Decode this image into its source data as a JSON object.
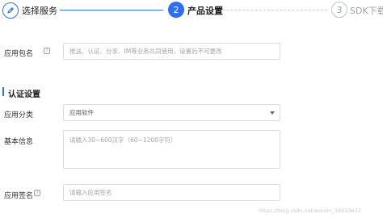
{
  "stepper": {
    "steps": [
      {
        "number": "",
        "label": "选择服务",
        "state": "done"
      },
      {
        "number": "2",
        "label": "产品设置",
        "state": "active"
      },
      {
        "number": "3",
        "label": "SDK下载",
        "state": "pending"
      }
    ]
  },
  "form": {
    "package_name": {
      "label": "应用包名",
      "help": "?",
      "placeholder": "推送、认证、分享、IM等业务共同使用，设置后不可更改"
    },
    "section_title": "认证设置",
    "category": {
      "label": "应用分类",
      "value": "应用软件"
    },
    "basic_info": {
      "label": "基本信息",
      "placeholder": "请输入30~600汉字（60~1200字符）"
    },
    "signature": {
      "label": "应用签名",
      "help": "?",
      "placeholder": "请输入应用签名"
    }
  },
  "watermark": "https://blog.csdn.net/weixin_39933633",
  "colors": {
    "accent": "#2c6ff0",
    "border": "#d9dce3",
    "muted": "#9aa0aa"
  }
}
